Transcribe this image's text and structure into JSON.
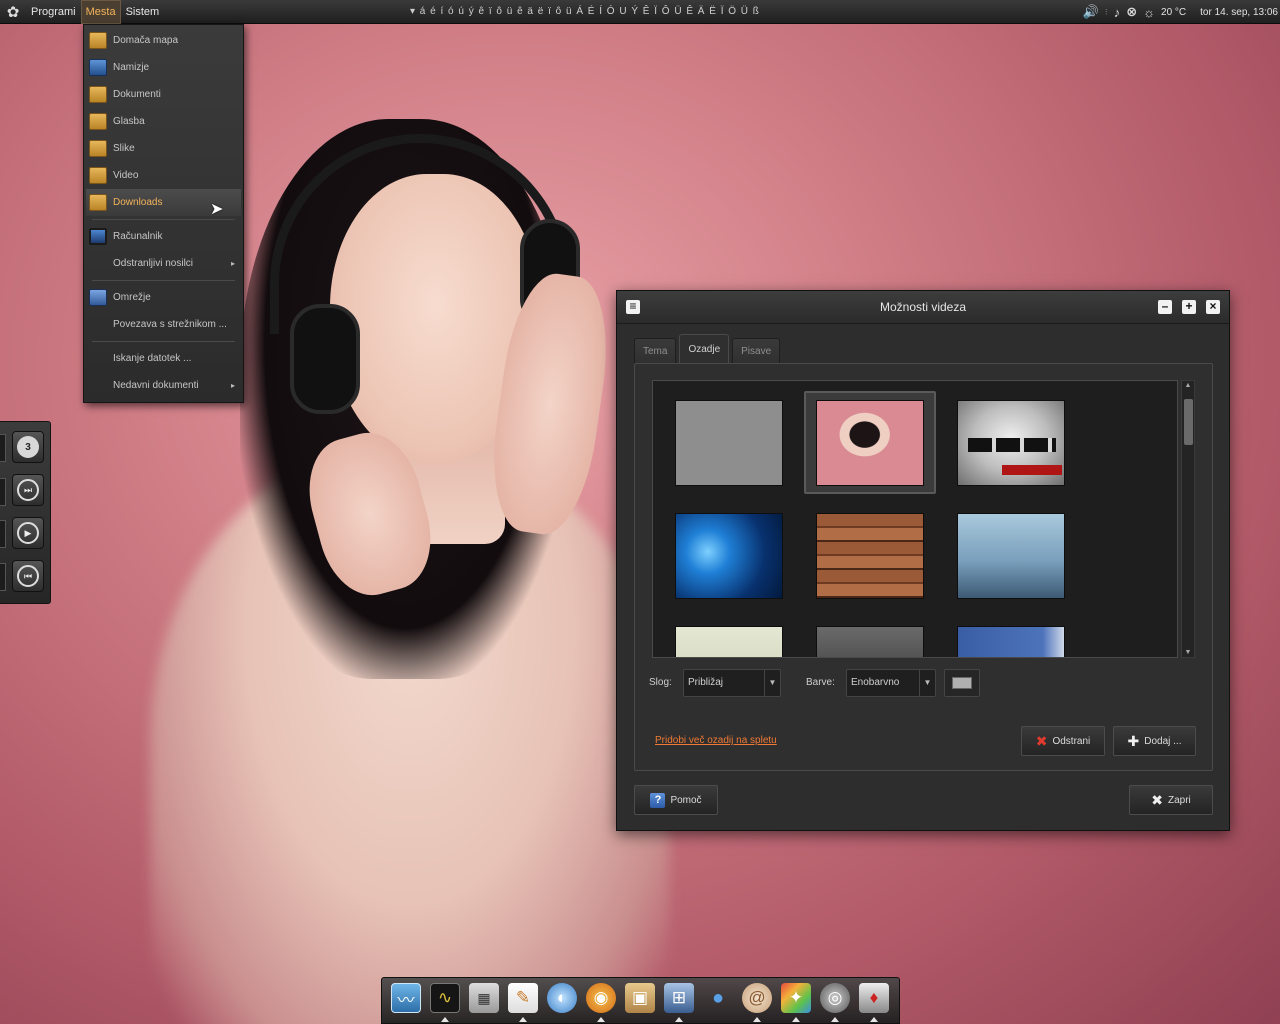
{
  "top_panel": {
    "menus": [
      "Programi",
      "Mesta",
      "Sistem"
    ],
    "active_menu": "Mesta",
    "char_strip": "▾  á é í ó ú ý ê ï ô ü ê ä ë ï ô ü Á É Í Ó U Ý Ê Ï Ô Ü Ê Ä Ë Ï Ö Ü ß",
    "tray": {
      "weather": "20 °C",
      "clock": "tor 14. sep, 13:06"
    },
    "icons": [
      "gnome-foot-icon",
      "volume-icon",
      "music-note-icon",
      "weather-sun-icon"
    ]
  },
  "places_menu": {
    "items": [
      {
        "label": "Domača mapa",
        "icon": "folder-home-icon",
        "kind": "folder"
      },
      {
        "label": "Namizje",
        "icon": "desktop-icon",
        "kind": "desk"
      },
      {
        "label": "Dokumenti",
        "icon": "folder-documents-icon",
        "kind": "folder"
      },
      {
        "label": "Glasba",
        "icon": "folder-music-icon",
        "kind": "folder"
      },
      {
        "label": "Slike",
        "icon": "folder-pictures-icon",
        "kind": "folder"
      },
      {
        "label": "Video",
        "icon": "folder-video-icon",
        "kind": "folder"
      },
      {
        "label": "Downloads",
        "icon": "folder-downloads-icon",
        "kind": "folder",
        "selected": true
      },
      {
        "label": "Računalnik",
        "icon": "computer-icon",
        "kind": "comp"
      },
      {
        "label": "Odstranljivi nosilci",
        "icon": "",
        "kind": "none",
        "submenu": true
      },
      {
        "label": "Omrežje",
        "icon": "network-icon",
        "kind": "net"
      },
      {
        "label": "Povezava s strežnikom ...",
        "icon": "",
        "kind": "none"
      },
      {
        "label": "Iskanje datotek ...",
        "icon": "",
        "kind": "none"
      },
      {
        "label": "Nedavni dokumenti",
        "icon": "",
        "kind": "none",
        "submenu": true
      }
    ]
  },
  "media_widget": {
    "badge": "3",
    "buttons": [
      "rotary-phone-icon",
      "fast-forward-icon",
      "play-icon",
      "rewind-icon"
    ]
  },
  "dialog": {
    "title": "Možnosti videza",
    "tabs": [
      "Tema",
      "Ozadje",
      "Pisave"
    ],
    "active_tab": "Ozadje",
    "style_label": "Slog:",
    "style_value": "Približaj",
    "colors_label": "Barve:",
    "colors_value": "Enobarvno",
    "swatch_color": "#b0b0b0",
    "get_more_link": "Pridobi več ozadij na spletu",
    "remove_button": "Odstrani",
    "add_button": "Dodaj ...",
    "help_button": "Pomoč",
    "close_button": "Zapri",
    "wallpapers": [
      "gray-solid",
      "woman-headphones",
      "bw-cars",
      "blue-bokeh",
      "wood-planks",
      "winter-city",
      "pale-sketch",
      "dark-gradient",
      "blue-sky"
    ],
    "selected_wallpaper": "woman-headphones"
  },
  "dock": {
    "items": [
      "system-monitor-icon",
      "activity-monitor-icon",
      "calculator-icon",
      "text-editor-icon",
      "browser-icon",
      "media-player-icon",
      "package-icon",
      "network-manager-icon",
      "water-drop-icon",
      "shell-icon",
      "paint-icon",
      "speaker-icon",
      "suit-icon"
    ]
  }
}
